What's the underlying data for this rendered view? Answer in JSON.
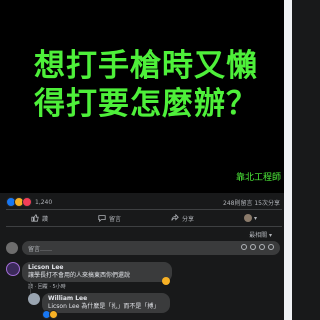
{
  "post": {
    "headline_line1": "想打手槍時又懶",
    "headline_line2": "得打要怎麼辦？",
    "watermark": "靠北工程師"
  },
  "stats": {
    "reactions": [
      "like-icon",
      "laugh-icon",
      "love-icon"
    ],
    "reaction_count": "1,240",
    "meta": "248則留言 15次分享"
  },
  "actions": {
    "like": "讚",
    "comment": "留言",
    "share": "分享"
  },
  "comments_header": {
    "sort": "最相關 ▾"
  },
  "composer": {
    "placeholder": "留言……"
  },
  "comments": [
    {
      "name": "Licson Lee",
      "text": "讓學長打不會用的人來搞東西你們還說",
      "links": "讚 · 回覆 · 5小時"
    },
    {
      "name": "William Lee",
      "text": "Licson Lee 為什麼是「扎」而不是「搏」",
      "reaction_badge": [
        "like-icon",
        "laugh-icon"
      ]
    }
  ],
  "colors": {
    "headline": "#4ef03a",
    "background": "#18191a",
    "bubble": "#3a3b3c"
  }
}
